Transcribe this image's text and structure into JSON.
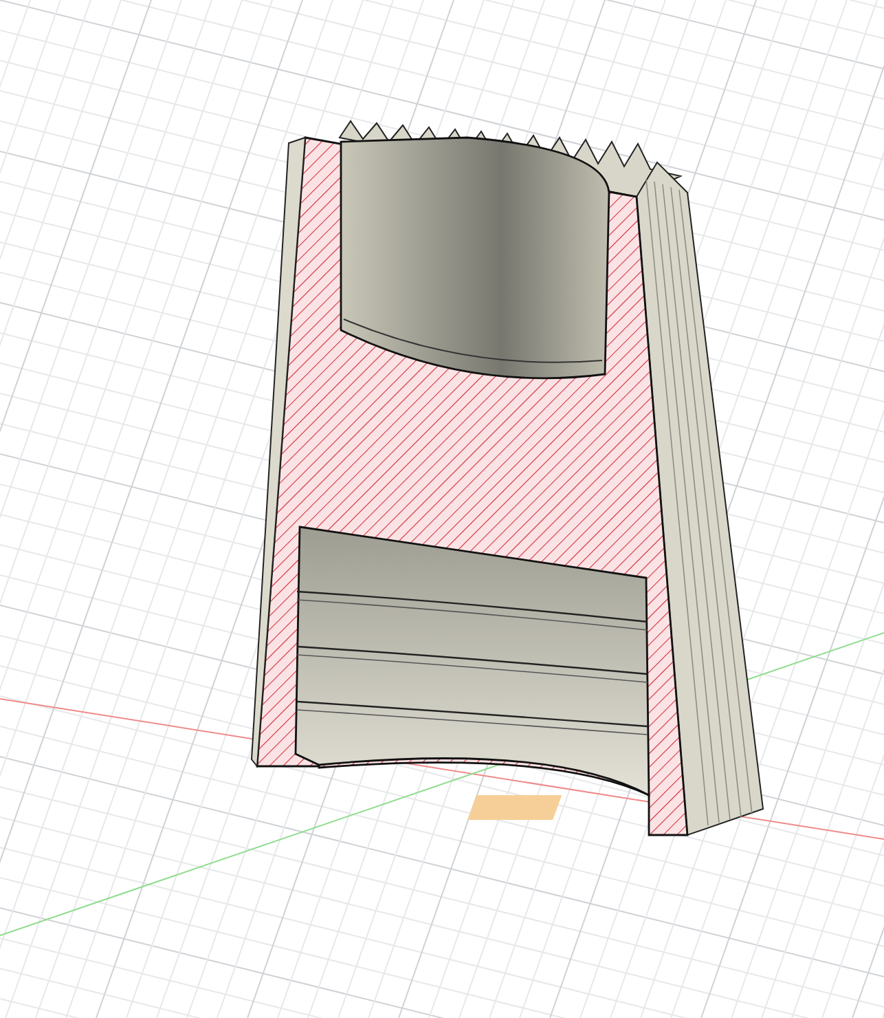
{
  "viewport": {
    "grid": true,
    "axes": true,
    "section_view": true
  }
}
